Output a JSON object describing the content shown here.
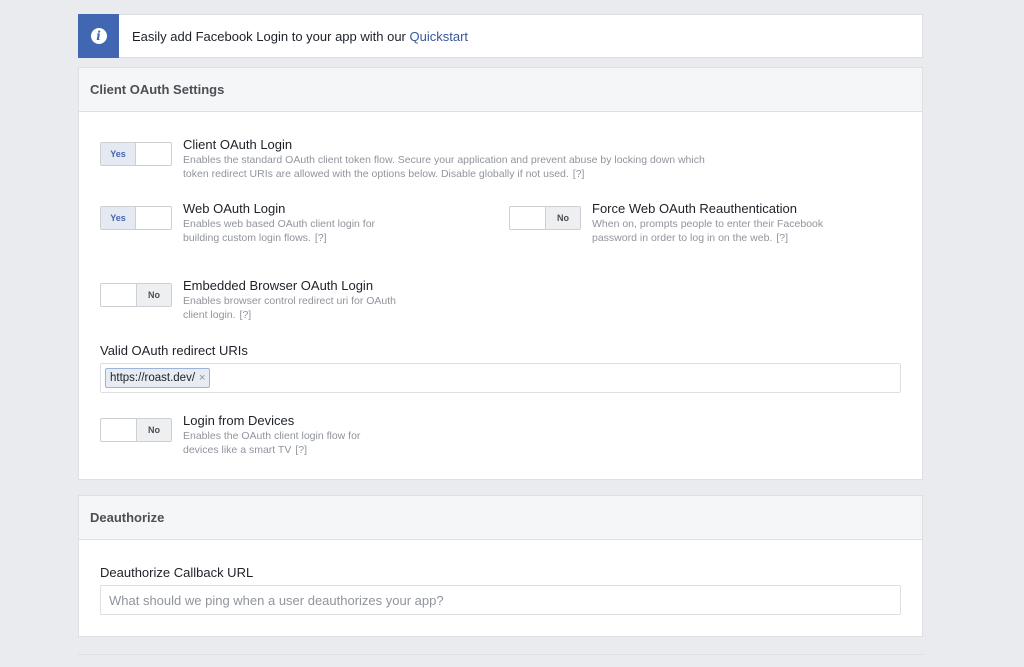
{
  "banner": {
    "text": "Easily add Facebook Login to your app with our ",
    "link": "Quickstart",
    "icon": "info-icon"
  },
  "oauth": {
    "title": "Client OAuth Settings",
    "settings": [
      {
        "title": "Client OAuth Login",
        "desc": "Enables the standard OAuth client token flow. Secure your application and prevent abuse by locking down which token redirect URIs are allowed with the options below. Disable globally if not used.",
        "help": "[?]",
        "state": "Yes"
      },
      {
        "title": "Web OAuth Login",
        "desc": "Enables web based OAuth client login for building custom login flows.",
        "help": "[?]",
        "state": "Yes"
      },
      {
        "title": "Force Web OAuth Reauthentication",
        "desc": "When on, prompts people to enter their Facebook password in order to log in on the web.",
        "help": "[?]",
        "state": "No"
      },
      {
        "title": "Embedded Browser OAuth Login",
        "desc": "Enables browser control redirect uri for OAuth client login.",
        "help": "[?]",
        "state": "No"
      },
      {
        "title": "Login from Devices",
        "desc": "Enables the OAuth client login flow for devices like a smart TV",
        "help": "[?]",
        "state": "No"
      }
    ],
    "redirect_label": "Valid OAuth redirect URIs",
    "redirect_uris": [
      "https://roast.dev/"
    ],
    "chip_remove": "×"
  },
  "deauth": {
    "title": "Deauthorize",
    "callback_label": "Deauthorize Callback URL",
    "callback_placeholder": "What should we ping when a user deauthorizes your app?",
    "callback_value": ""
  },
  "colors": {
    "accent": "#4267b2",
    "link": "#365899",
    "page_bg": "#e9ebee"
  }
}
